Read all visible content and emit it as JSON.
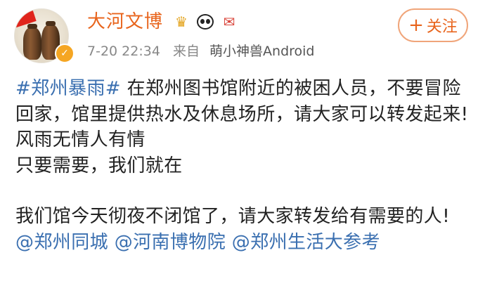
{
  "header": {
    "name": "大河文博",
    "time": "7-20 22:34",
    "source_prefix": "来自",
    "device": "萌小神兽Android",
    "follow_label": "关注",
    "follow_plus": "+",
    "verify_mark": "✓"
  },
  "post": {
    "topic": "#郑州暴雨#",
    "line1_rest": " 在郑州图书馆附近的被困人员，不要冒险回家，馆里提供热水及休息场所，请大家可以转发起来!",
    "line2": "风雨无情人有情",
    "line3": "只要需要，我们就在",
    "line4": "我们馆今天彻夜不闭馆了，请大家转发给有需要的人! ",
    "mentions": [
      "@郑州同城",
      "@河南博物院",
      "@郑州生活大参考"
    ]
  },
  "colors": {
    "name": "#e8641c",
    "link": "#3a6fb0",
    "meta": "#888888"
  },
  "icons": [
    "crown-icon",
    "panda-icon",
    "gift-icon",
    "verified-icon",
    "plus-icon"
  ]
}
